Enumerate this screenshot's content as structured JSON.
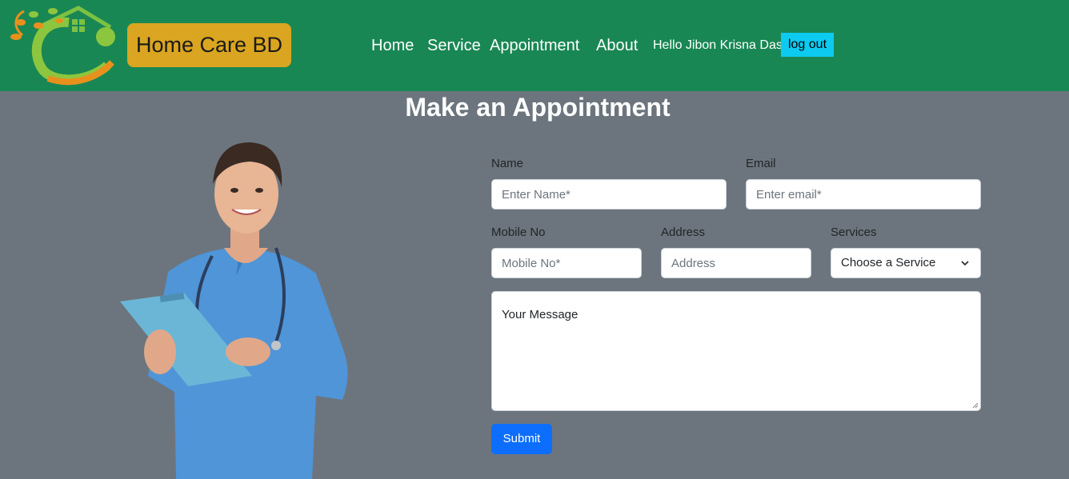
{
  "header": {
    "brand": "Home Care BD",
    "nav": [
      {
        "label": "Home"
      },
      {
        "label": "Service"
      },
      {
        "label": "Appointment"
      },
      {
        "label": "About"
      }
    ],
    "greeting": "Hello Jibon Krisna Das",
    "logout_label": "log out"
  },
  "main": {
    "title": "Make an Appointment",
    "form": {
      "name_label": "Name",
      "name_placeholder": "Enter Name*",
      "email_label": "Email",
      "email_placeholder": "Enter email*",
      "mobile_label": "Mobile No",
      "mobile_placeholder": "Mobile No*",
      "address_label": "Address",
      "address_placeholder": "Address",
      "services_label": "Services",
      "services_selected": "Choose a Service",
      "message_text": "Your Message",
      "submit_label": "Submit"
    }
  },
  "colors": {
    "navbar": "#198754",
    "brand_bg": "#DAA520",
    "logout_bg": "#0dcaf0",
    "page_bg": "#6c757d",
    "submit_bg": "#0d6efd"
  },
  "icons": [
    "home-care-logo-icon",
    "chevron-down-icon",
    "resize-handle-icon"
  ]
}
